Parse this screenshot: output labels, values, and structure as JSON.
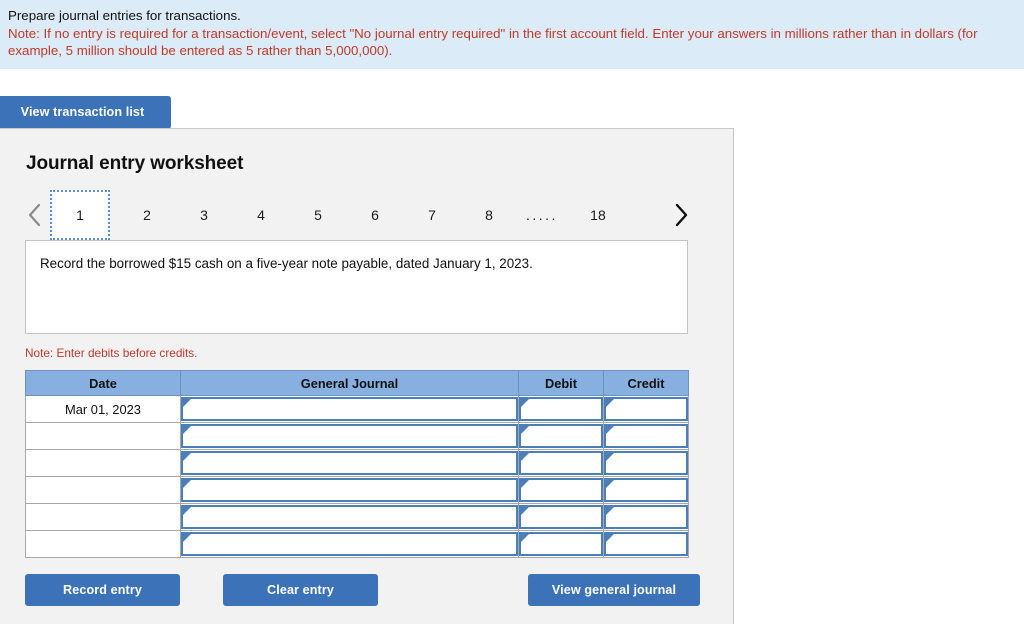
{
  "banner": {
    "line1": "Prepare journal entries for transactions.",
    "note": "Note: If no entry is required for a transaction/event, select \"No journal entry required\" in the first account field. Enter your answers in millions rather than in dollars (for example, 5 million should be entered as 5 rather than 5,000,000)."
  },
  "toolbar": {
    "view_transaction_list": "View transaction list"
  },
  "panel": {
    "title": "Journal entry worksheet"
  },
  "pager": {
    "prev_icon": "chevron-left-icon",
    "next_icon": "chevron-right-icon",
    "pages": [
      "1",
      "2",
      "3",
      "4",
      "5",
      "6",
      "7",
      "8"
    ],
    "ellipsis": ".....",
    "last_page": "18",
    "active_page": "1"
  },
  "description": {
    "text": "Record the borrowed $15 cash on a five-year note payable, dated January 1, 2023."
  },
  "note_small": "Note: Enter debits before credits.",
  "table": {
    "headers": [
      "Date",
      "General Journal",
      "Debit",
      "Credit"
    ],
    "rows": [
      {
        "date": "Mar 01, 2023",
        "general_journal": "",
        "debit": "",
        "credit": ""
      },
      {
        "date": "",
        "general_journal": "",
        "debit": "",
        "credit": ""
      },
      {
        "date": "",
        "general_journal": "",
        "debit": "",
        "credit": ""
      },
      {
        "date": "",
        "general_journal": "",
        "debit": "",
        "credit": ""
      },
      {
        "date": "",
        "general_journal": "",
        "debit": "",
        "credit": ""
      },
      {
        "date": "",
        "general_journal": "",
        "debit": "",
        "credit": ""
      }
    ]
  },
  "footer": {
    "record_entry": "Record entry",
    "clear_entry": "Clear entry",
    "view_general_journal": "View general journal"
  },
  "colors": {
    "banner_bg": "#dcebf8",
    "note_red": "#c0392b",
    "button_blue": "#3c73b8",
    "table_header_blue": "#87b0e0",
    "input_border_blue": "#4a7fba",
    "panel_bg": "#f2f2f2"
  }
}
